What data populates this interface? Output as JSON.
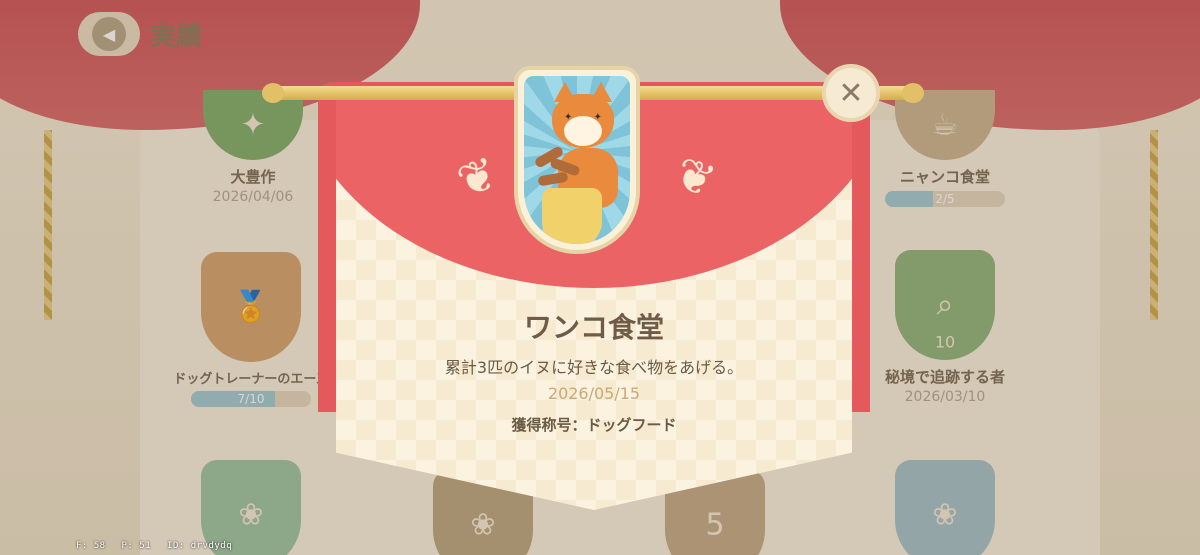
{
  "header": {
    "title": "実績"
  },
  "achievements": {
    "harvest": {
      "name": "大豊作",
      "date": "2026/04/06"
    },
    "cat_diner": {
      "name": "ニャンコ食堂",
      "progress_text": "2/5",
      "progress": 0.4
    },
    "dog_trainer": {
      "name": "ドッグトレーナーのエース",
      "progress_text": "7/10",
      "progress": 0.7
    },
    "tracker": {
      "name": "秘境で追跡する者",
      "date": "2026/03/10",
      "badge_number": "10"
    },
    "bottom_star_number": "5"
  },
  "popup": {
    "title": "ワンコ食堂",
    "description": "累計3匹のイヌに好きな食べ物をあげる。",
    "date": "2026/05/15",
    "reward": "獲得称号：ドッグフード",
    "close_label": "✕"
  },
  "debug": {
    "f": "F: 58",
    "p": "P: 51",
    "id": "ID: drvdydq"
  },
  "colors": {
    "banner_red": "#e45a5c",
    "banner_cream": "#fbf3df",
    "title_brown": "#6f5b47",
    "date_gold": "#c9a977",
    "progress_blue": "#9fc9d3"
  }
}
